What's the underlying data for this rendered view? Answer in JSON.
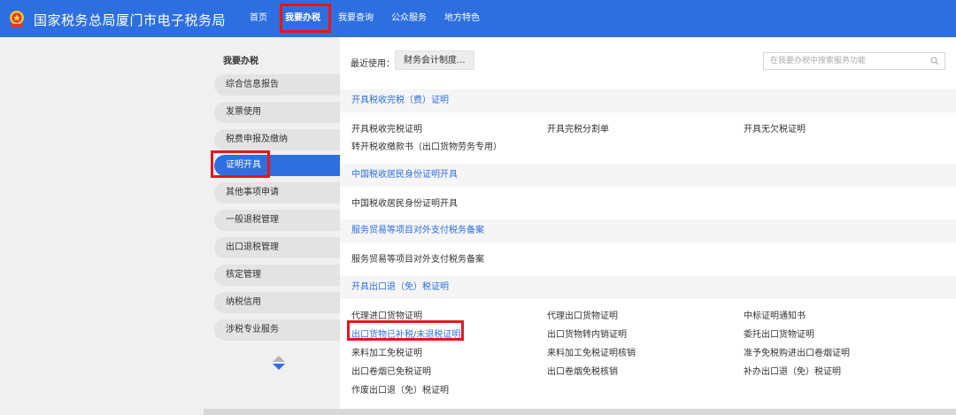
{
  "header": {
    "site_title": "国家税务总局厦门市电子税务局",
    "logo_icon": "tax-emblem-icon",
    "nav": [
      "首页",
      "我要办税",
      "我要查询",
      "公众服务",
      "地方特色"
    ],
    "active_nav": "我要办税"
  },
  "sidebar": {
    "title": "我要办税",
    "items": [
      "综合信息报告",
      "发票使用",
      "税费申报及缴纳",
      "证明开具",
      "其他事项申请",
      "一般退税管理",
      "出口退税管理",
      "核定管理",
      "纳税信用",
      "涉税专业服务"
    ],
    "active_item": "证明开具"
  },
  "main": {
    "recent_label": "最近使用：",
    "recent_chip": "财务会计制度...",
    "search_placeholder": "在我要办税中搜索服务功能",
    "sections": [
      {
        "title": "开具税收完税（费）证明",
        "rows": [
          [
            "开具税收完税证明",
            "开具完税分割单",
            "开具无欠税证明"
          ],
          [
            "转开税收缴款书（出口货物劳务专用）"
          ]
        ]
      },
      {
        "title": "中国税收居民身份证明开具",
        "rows": [
          [
            "中国税收居民身份证明开具"
          ]
        ]
      },
      {
        "title": "服务贸易等项目对外支付税务备案",
        "rows": [
          [
            "服务贸易等项目对外支付税务备案"
          ]
        ]
      },
      {
        "title": "开具出口退（免）税证明",
        "rows": [
          [
            "代理进口货物证明",
            "代理出口货物证明",
            "中标证明通知书"
          ],
          [
            "出口货物已补税/未退税证明",
            "出口货物转内销证明",
            "委托出口货物证明"
          ],
          [
            "来料加工免税证明",
            "来料加工免税证明核销",
            "准予免税购进出口卷烟证明"
          ],
          [
            "出口卷烟已免税证明",
            "出口卷烟免税核销",
            "补办出口退（免）税证明"
          ],
          [
            "作废出口退（免）税证明"
          ]
        ]
      }
    ]
  },
  "colors": {
    "brand_blue": "#2d6fe0",
    "highlight_red": "#e8151c"
  }
}
